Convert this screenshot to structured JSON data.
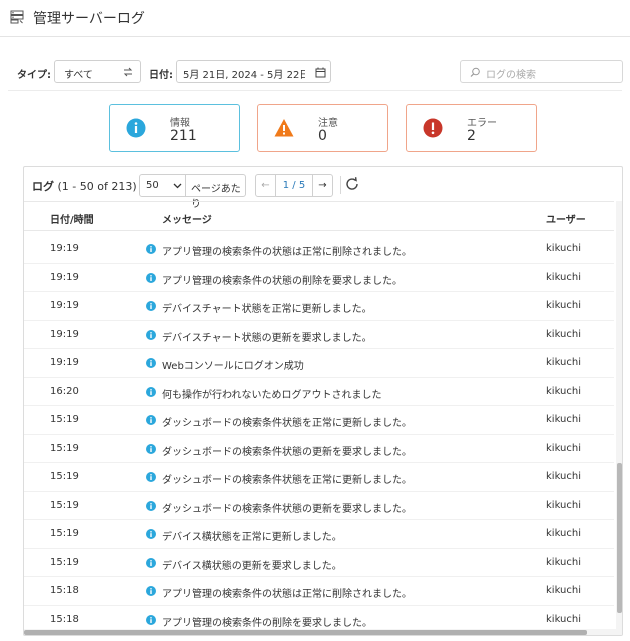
{
  "header": {
    "title": "管理サーバーログ",
    "icon": "server-log-icon"
  },
  "filters": {
    "type_label": "タイプ:",
    "type_value": "すべて",
    "date_label": "日付:",
    "date_value": "5月 21日, 2024 - 5月 22日,…",
    "search_placeholder": "ログの検索"
  },
  "summary": {
    "info": {
      "label": "情報",
      "count": "211",
      "color": "#2ba7dc"
    },
    "warning": {
      "label": "注意",
      "count": "0",
      "color": "#f07a1a"
    },
    "error": {
      "label": "エラー",
      "count": "2",
      "color": "#c8372a"
    }
  },
  "log": {
    "title": "ログ",
    "range": "(1 - 50 of 213)",
    "per_page_value": "50",
    "per_page_label": "ページあたり",
    "page_indicator": "1 / 5",
    "prev": "←",
    "next": "→",
    "columns": {
      "datetime": "日付/時間",
      "message": "メッセージ",
      "user": "ユーザー"
    },
    "rows": [
      {
        "time": "19:19",
        "message": "アプリ管理の検索条件の状態は正常に削除されました。",
        "user": "kikuchi"
      },
      {
        "time": "19:19",
        "message": "アプリ管理の検索条件の状態の削除を要求しました。",
        "user": "kikuchi"
      },
      {
        "time": "19:19",
        "message": "デバイスチャート状態を正常に更新しました。",
        "user": "kikuchi"
      },
      {
        "time": "19:19",
        "message": "デバイスチャート状態の更新を要求しました。",
        "user": "kikuchi"
      },
      {
        "time": "19:19",
        "message": "Webコンソールにログオン成功",
        "user": "kikuchi"
      },
      {
        "time": "16:20",
        "message": "何も操作が行われないためログアウトされました",
        "user": "kikuchi"
      },
      {
        "time": "15:19",
        "message": "ダッシュボードの検索条件状態を正常に更新しました。",
        "user": "kikuchi"
      },
      {
        "time": "15:19",
        "message": "ダッシュボードの検索条件状態の更新を要求しました。",
        "user": "kikuchi"
      },
      {
        "time": "15:19",
        "message": "ダッシュボードの検索条件状態を正常に更新しました。",
        "user": "kikuchi"
      },
      {
        "time": "15:19",
        "message": "ダッシュボードの検索条件状態の更新を要求しました。",
        "user": "kikuchi"
      },
      {
        "time": "15:19",
        "message": "デバイス横状態を正常に更新しました。",
        "user": "kikuchi"
      },
      {
        "time": "15:19",
        "message": "デバイス横状態の更新を要求しました。",
        "user": "kikuchi"
      },
      {
        "time": "15:18",
        "message": "アプリ管理の検索条件の状態は正常に削除されました。",
        "user": "kikuchi"
      },
      {
        "time": "15:18",
        "message": "アプリ管理の検索条件の削除を要求しました。",
        "user": "kikuchi"
      }
    ]
  }
}
